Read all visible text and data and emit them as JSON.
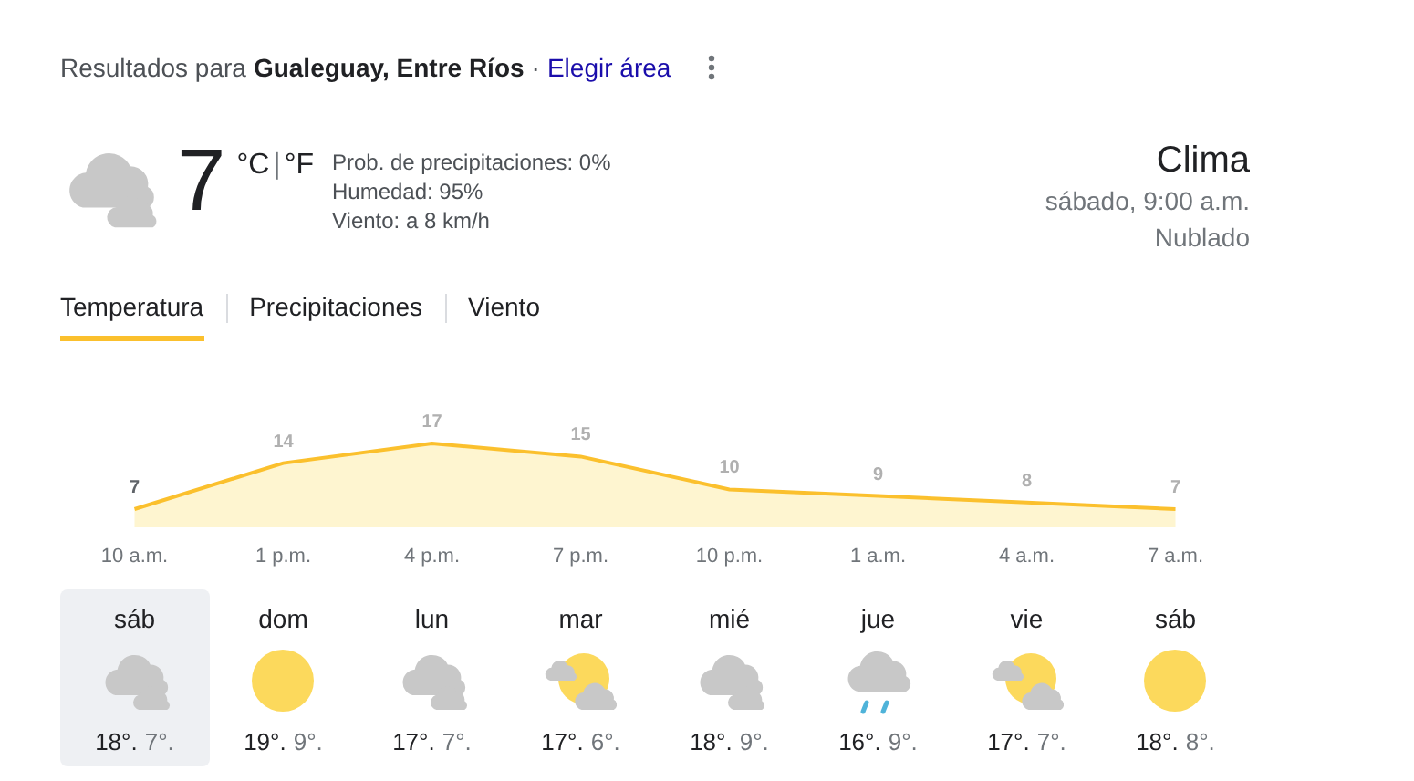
{
  "header": {
    "prefix": "Resultados para",
    "location": "Gualeguay, Entre Ríos",
    "separator": "·",
    "link": "Elegir área"
  },
  "current": {
    "kind": "cloudy",
    "temperature": "7",
    "unit_c": "°C",
    "unit_sep": "|",
    "unit_f": "°F",
    "details": [
      "Prob. de precipitaciones: 0%",
      "Humedad: 95%",
      "Viento: a 8 km/h"
    ]
  },
  "summary": {
    "title": "Clima",
    "time": "sábado, 9:00 a.m.",
    "condition": "Nublado"
  },
  "tabs": [
    {
      "label": "Temperatura",
      "selected": true
    },
    {
      "label": "Precipitaciones",
      "selected": false
    },
    {
      "label": "Viento",
      "selected": false
    }
  ],
  "chart_data": {
    "type": "area",
    "categories": [
      "10 a.m.",
      "1 p.m.",
      "4 p.m.",
      "7 p.m.",
      "10 p.m.",
      "1 a.m.",
      "4 a.m.",
      "7 a.m."
    ],
    "series": [
      {
        "color": "#fbc02d",
        "values": [
          7,
          14,
          17,
          15,
          10,
          9,
          8,
          7
        ]
      }
    ],
    "data_labels": true
  },
  "days": [
    {
      "day": "sáb",
      "kind": "cloudy",
      "high": "18°.",
      "low": "7°.",
      "selected": true
    },
    {
      "day": "dom",
      "kind": "sunny",
      "high": "19°.",
      "low": "9°.",
      "selected": false
    },
    {
      "day": "lun",
      "kind": "cloudy",
      "high": "17°.",
      "low": "7°.",
      "selected": false
    },
    {
      "day": "mar",
      "kind": "partly_cloudy",
      "high": "17°.",
      "low": "6°.",
      "selected": false
    },
    {
      "day": "mié",
      "kind": "cloudy",
      "high": "18°.",
      "low": "9°.",
      "selected": false
    },
    {
      "day": "jue",
      "kind": "rain",
      "high": "16°.",
      "low": "9°.",
      "selected": false
    },
    {
      "day": "vie",
      "kind": "partly_cloudy",
      "high": "17°.",
      "low": "7°.",
      "selected": false
    },
    {
      "day": "sáb",
      "kind": "sunny",
      "high": "18°.",
      "low": "8°.",
      "selected": false
    }
  ]
}
